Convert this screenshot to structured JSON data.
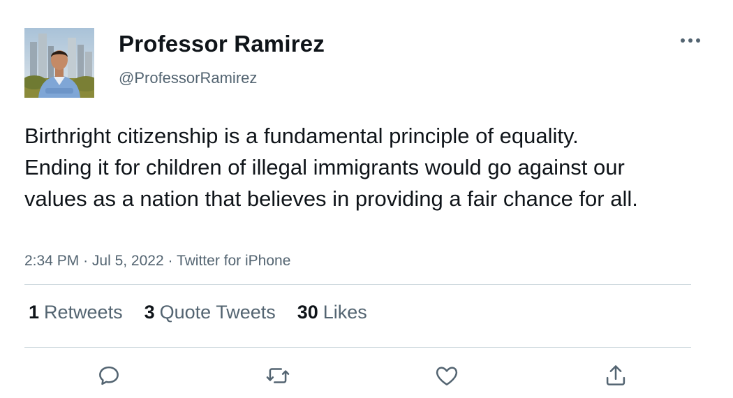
{
  "author": {
    "display_name": "Professor Ramirez",
    "handle": "@ProfessorRamirez"
  },
  "tweet": {
    "text": "Birthright citizenship is a fundamental principle of equality. Ending it for children of illegal immigrants would go against our values as a nation that believes in providing a fair chance for all.",
    "time": "2:34 PM",
    "date": "Jul 5, 2022",
    "source": "Twitter for iPhone",
    "separator": "·"
  },
  "stats": {
    "retweets_count": "1",
    "retweets_label": "Retweets",
    "quotes_count": "3",
    "quotes_label": "Quote Tweets",
    "likes_count": "30",
    "likes_label": "Likes"
  },
  "icons": {
    "more": "more-horizontal-icon",
    "reply": "reply-icon",
    "retweet": "retweet-icon",
    "like": "heart-icon",
    "share": "share-icon"
  },
  "colors": {
    "text_primary": "#0f1419",
    "text_secondary": "#536471",
    "divider": "#cfd9de"
  }
}
